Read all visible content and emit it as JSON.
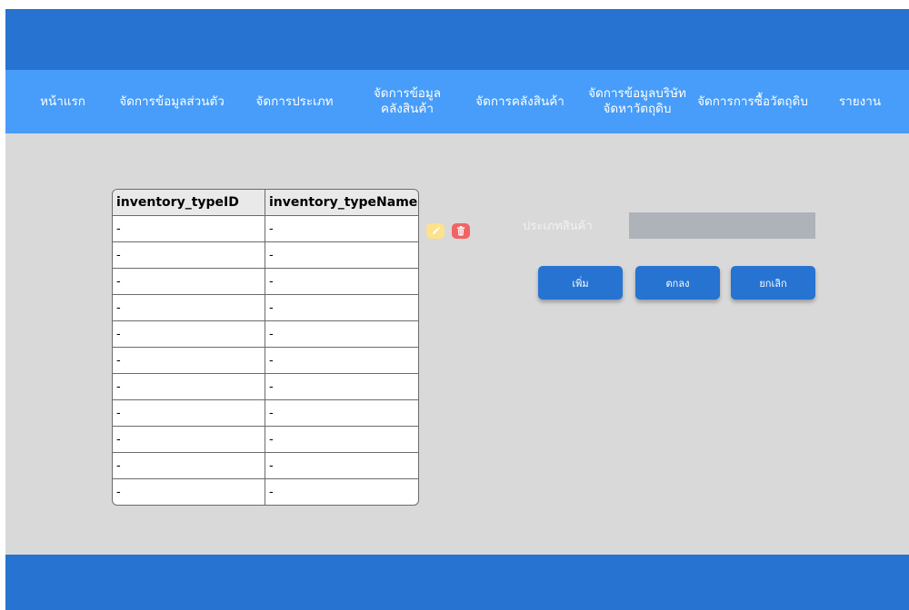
{
  "nav": {
    "items": [
      {
        "label": "หน้าแรก"
      },
      {
        "label": "จัดการข้อมูลส่วนตัว"
      },
      {
        "label": "จัดการประเภท"
      },
      {
        "label": "จัดการข้อมูล\nคลังสินค้า"
      },
      {
        "label": "จัดการคลังสินค้า"
      },
      {
        "label": "จัดการข้อมูลบริษัท\nจัดหาวัตถุดิบ"
      },
      {
        "label": "จัดการการซื้อวัตถุดิบ"
      },
      {
        "label": "รายงาน"
      }
    ]
  },
  "table": {
    "headers": [
      "inventory_typeID",
      "inventory_typeName"
    ],
    "rows": [
      [
        "-",
        "-"
      ],
      [
        "-",
        "-"
      ],
      [
        "-",
        "-"
      ],
      [
        "-",
        "-"
      ],
      [
        "-",
        "-"
      ],
      [
        "-",
        "-"
      ],
      [
        "-",
        "-"
      ],
      [
        "-",
        "-"
      ],
      [
        "-",
        "-"
      ],
      [
        "-",
        "-"
      ],
      [
        "-",
        "-"
      ]
    ]
  },
  "form": {
    "label": "ประเภทสินค้า",
    "value": "",
    "add_label": "เพิ่ม",
    "ok_label": "ตกลง",
    "cancel_label": "ยกเลิก"
  },
  "icons": {
    "edit": "pencil-icon",
    "delete": "trash-icon"
  },
  "colors": {
    "header": "#2673d1",
    "nav": "#479df9",
    "content": "#d9d9d9",
    "edit": "#fde28c",
    "delete": "#f26363"
  }
}
